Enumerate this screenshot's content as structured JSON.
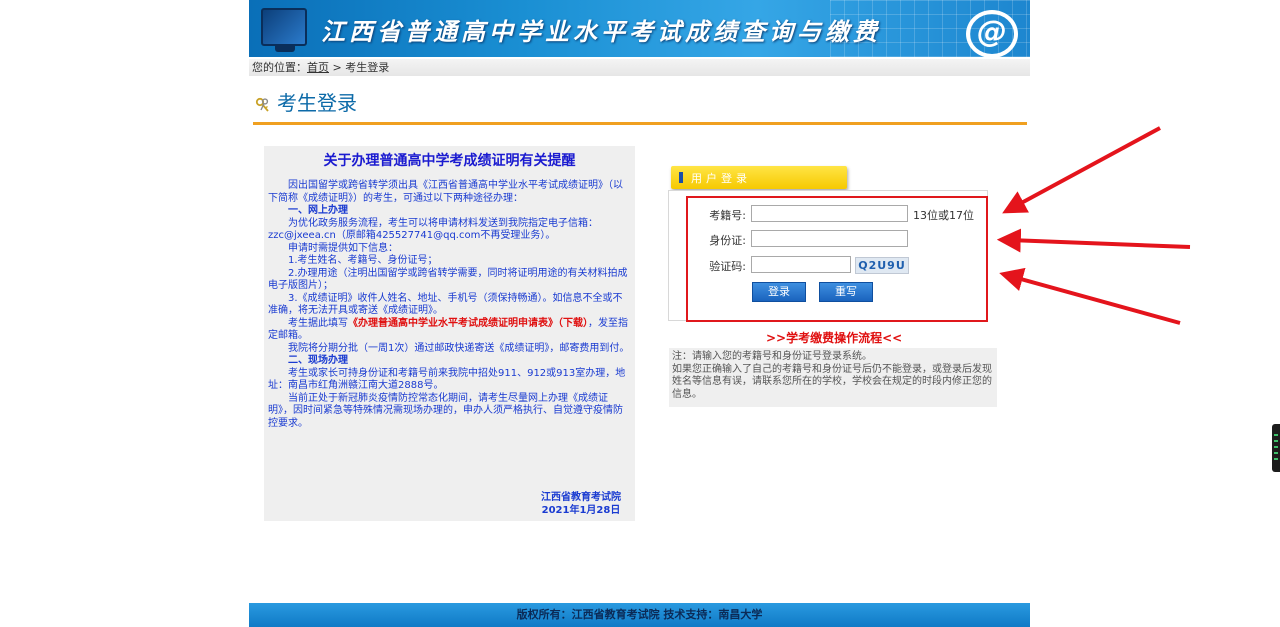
{
  "header": {
    "title": "江西省普通高中学业水平考试成绩查询与缴费",
    "logo_icon": "at-sign-icon"
  },
  "breadcrumb": {
    "prefix": "您的位置：",
    "home": "首页",
    "separator": " > ",
    "current": "考生登录"
  },
  "page_title": "考生登录",
  "notice": {
    "title": "关于办理普通高中学考成绩证明有关提醒",
    "intro": "因出国留学或跨省转学须出具《江西省普通高中学业水平考试成绩证明》（以下简称《成绩证明》）的考生，可通过以下两种途径办理：",
    "section1": "一、网上办理",
    "p1": "为优化政务服务流程，考生可以将申请材料发送到我院指定电子信箱：zzc@jxeea.cn（原邮箱425527741@qq.com不再受理业务）。",
    "p2": "申请时需提供如下信息：",
    "p3": "1.考生姓名、考籍号、身份证号；",
    "p4": "2.办理用途（注明出国留学或跨省转学需要，同时将证明用途的有关材料拍成电子版图片）；",
    "p5": "3.《成绩证明》收件人姓名、地址、手机号（须保持畅通）。如信息不全或不准确，将无法开具或寄送《成绩证明》。",
    "p6_pre": "考生据此填写",
    "p6_link": "《办理普通高中学业水平考试成绩证明申请表》（下载）",
    "p6_post": "，发至指定邮箱。",
    "p7": "我院将分期分批（一周1次）通过邮政快递寄送《成绩证明》，邮寄费用到付。",
    "section2": "二、现场办理",
    "p8": "考生或家长可持身份证和考籍号前来我院中招处911、912或913室办理，地址：南昌市红角洲赣江南大道2888号。",
    "p9": "当前正处于新冠肺炎疫情防控常态化期间，请考生尽量网上办理《成绩证明》，因时间紧急等特殊情况需现场办理的，申办人须严格执行、自觉遵守疫情防控要求。",
    "signature": "江西省教育考试院",
    "date": "2021年1月28日"
  },
  "login": {
    "tab_label": "用户登录",
    "exam_id_label": "考籍号:",
    "exam_id_value": "",
    "exam_id_hint": "13位或17位",
    "id_card_label": "身份证:",
    "id_card_value": "",
    "captcha_label": "验证码:",
    "captcha_value": "",
    "captcha_code": "Q2U9U",
    "login_button": "登录",
    "reset_button": "重写"
  },
  "fee_flow_link": ">>学考缴费操作流程<<",
  "note": "注：请输入您的考籍号和身份证号登录系统。\n如果您正确输入了自己的考籍号和身份证号后仍不能登录，或登录后发现姓名等信息有误，请联系您所在的学校，学校会在规定的时段内修正您的信息。",
  "footer": "版权所有：江西省教育考试院 技术支持：南昌大学",
  "colors": {
    "banner_blue": "#1a8fd3",
    "title_blue": "#0c6aa8",
    "rule_orange": "#f0a020",
    "notice_text": "#1a3bd1",
    "alert_red": "#e01010",
    "tab_yellow": "#f6c900",
    "button_blue": "#1a63bd"
  }
}
